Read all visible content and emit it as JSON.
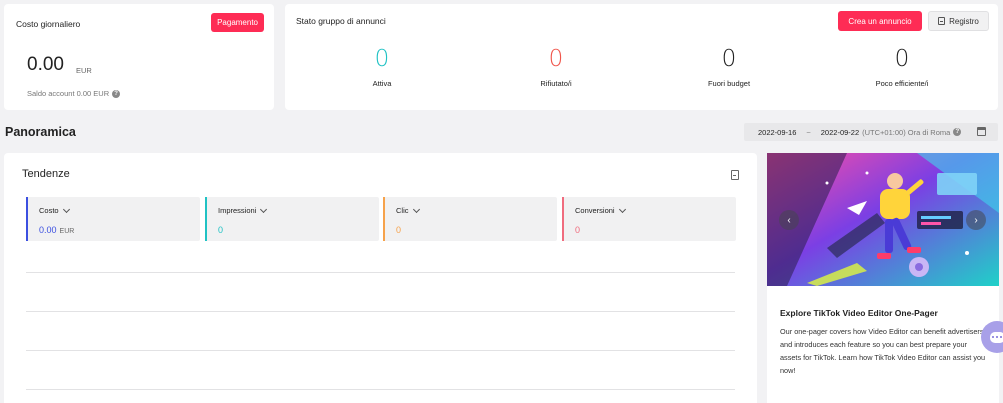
{
  "daily_cost": {
    "title": "Costo giornaliero",
    "pay_button": "Pagamento",
    "amount": "0.00",
    "currency": "EUR",
    "balance": "Saldo account 0.00 EUR",
    "help_icon": "question-circle-icon"
  },
  "ad_group_status": {
    "title": "Stato gruppo di annunci",
    "create_button": "Crea un annuncio",
    "registry_button": "Registro",
    "metrics": [
      {
        "value": "0",
        "label": "Attiva",
        "color": "#20c2c4"
      },
      {
        "value": "0",
        "label": "Rifiutato/i",
        "color": "#f0554b"
      },
      {
        "value": "0",
        "label": "Fuori budget",
        "color": "#222222"
      },
      {
        "value": "0",
        "label": "Poco efficiente/i",
        "color": "#222222"
      }
    ]
  },
  "overview": {
    "title": "Panoramica",
    "date_start": "2022-09-16",
    "date_sep": "~",
    "date_end": "2022-09-22",
    "timezone": "(UTC+01:00) Ora di Roma"
  },
  "trends": {
    "title": "Tendenze",
    "metrics": [
      {
        "label": "Costo",
        "value": "0.00",
        "unit": "EUR",
        "color": "#3b4fe0"
      },
      {
        "label": "Impressioni",
        "value": "0",
        "unit": "",
        "color": "#20c2c4"
      },
      {
        "label": "Clic",
        "value": "0",
        "unit": "",
        "color": "#f6a24b"
      },
      {
        "label": "Conversioni",
        "value": "0",
        "unit": "",
        "color": "#f06c7e"
      }
    ]
  },
  "promo": {
    "title": "Explore TikTok Video Editor One-Pager",
    "description": "Our one-pager covers how Video Editor can benefit advertisers, and introduces each feature so you can best prepare your assets for TikTok. Learn how TikTok Video Editor can assist you now!",
    "prev": "‹",
    "next": "›"
  }
}
